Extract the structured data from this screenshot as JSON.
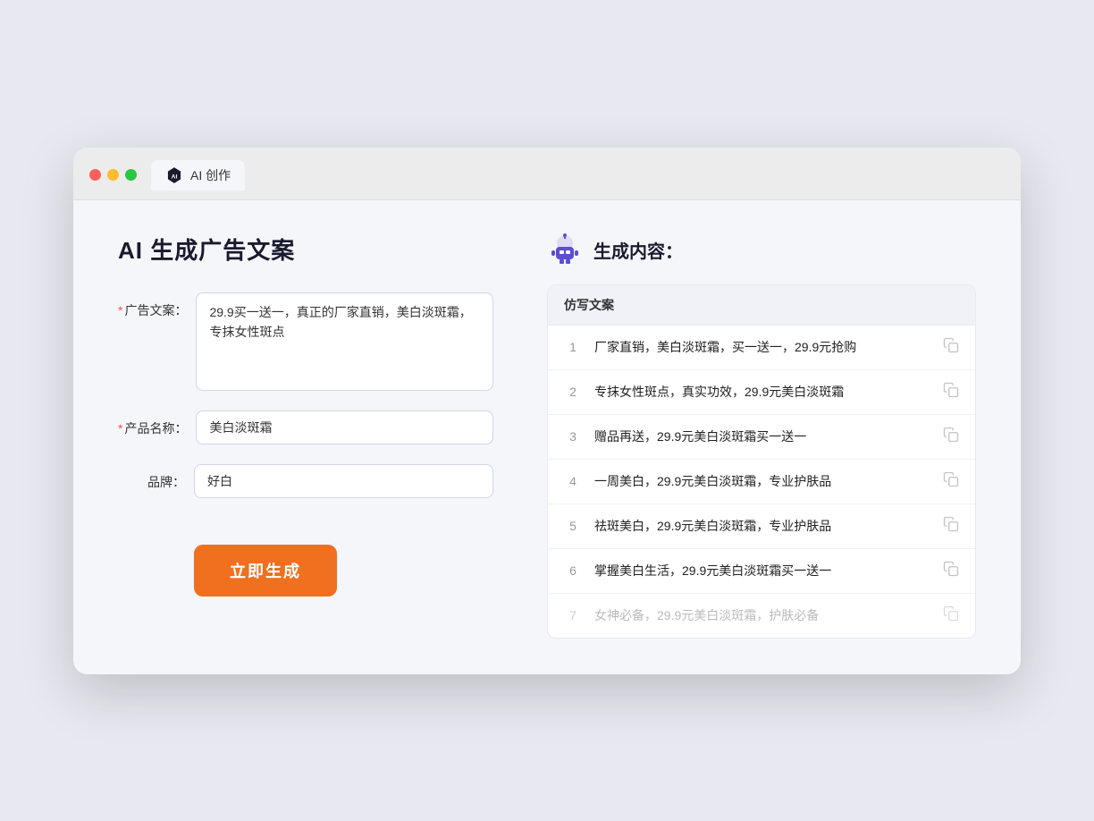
{
  "browser": {
    "tab_label": "AI 创作"
  },
  "page": {
    "title": "AI 生成广告文案"
  },
  "form": {
    "ad_copy_label": "广告文案：",
    "ad_copy_required": "*",
    "ad_copy_value": "29.9买一送一，真正的厂家直销，美白淡斑霜，专抹女性斑点",
    "product_name_label": "产品名称：",
    "product_name_required": "*",
    "product_name_value": "美白淡斑霜",
    "brand_label": "品牌：",
    "brand_value": "好白",
    "generate_button": "立即生成"
  },
  "result": {
    "header_title": "生成内容：",
    "table_header": "仿写文案",
    "rows": [
      {
        "num": "1",
        "text": "厂家直销，美白淡斑霜，买一送一，29.9元抢购",
        "faded": false
      },
      {
        "num": "2",
        "text": "专抹女性斑点，真实功效，29.9元美白淡斑霜",
        "faded": false
      },
      {
        "num": "3",
        "text": "赠品再送，29.9元美白淡斑霜买一送一",
        "faded": false
      },
      {
        "num": "4",
        "text": "一周美白，29.9元美白淡斑霜，专业护肤品",
        "faded": false
      },
      {
        "num": "5",
        "text": "祛斑美白，29.9元美白淡斑霜，专业护肤品",
        "faded": false
      },
      {
        "num": "6",
        "text": "掌握美白生活，29.9元美白淡斑霜买一送一",
        "faded": false
      },
      {
        "num": "7",
        "text": "女神必备，29.9元美白淡斑霜，护肤必备",
        "faded": true
      }
    ]
  },
  "colors": {
    "orange": "#f07020",
    "required": "#ff4d4f"
  }
}
